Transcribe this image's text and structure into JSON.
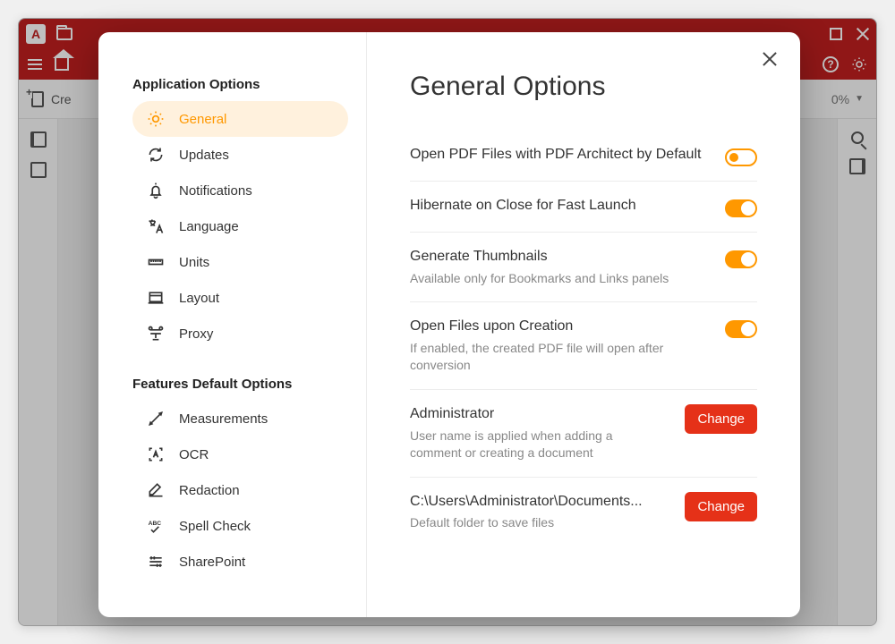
{
  "titlebar": {
    "app_letter": "A"
  },
  "toolbar": {
    "create_label": "Cre",
    "zoom": "0%"
  },
  "modal": {
    "heading": "General Options"
  },
  "sidebar": {
    "section1_title": "Application Options",
    "section2_title": "Features Default Options",
    "items1": [
      {
        "label": "General"
      },
      {
        "label": "Updates"
      },
      {
        "label": "Notifications"
      },
      {
        "label": "Language"
      },
      {
        "label": "Units"
      },
      {
        "label": "Layout"
      },
      {
        "label": "Proxy"
      }
    ],
    "items2": [
      {
        "label": "Measurements"
      },
      {
        "label": "OCR"
      },
      {
        "label": "Redaction"
      },
      {
        "label": "Spell Check"
      },
      {
        "label": "SharePoint"
      }
    ]
  },
  "options": [
    {
      "title": "Open PDF Files with PDF Architect by Default",
      "sub": "",
      "ctrl": "toggle-outline"
    },
    {
      "title": "Hibernate on Close for Fast Launch",
      "sub": "",
      "ctrl": "toggle-on"
    },
    {
      "title": "Generate Thumbnails",
      "sub": "Available only for Bookmarks and Links panels",
      "ctrl": "toggle-on"
    },
    {
      "title": "Open Files upon Creation",
      "sub": "If enabled, the created PDF file will open after conversion",
      "ctrl": "toggle-on"
    },
    {
      "title": "Administrator",
      "sub": "User name is applied when adding a comment or creating a document",
      "ctrl": "change",
      "btn": "Change"
    },
    {
      "title": "C:\\Users\\Administrator\\Documents...",
      "sub": "Default folder to save files",
      "ctrl": "change",
      "btn": "Change"
    }
  ]
}
